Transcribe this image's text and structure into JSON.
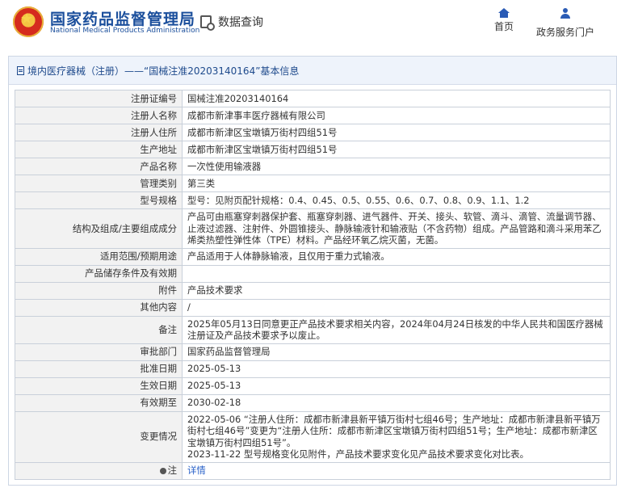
{
  "header": {
    "brand_cn": "国家药品监督管理局",
    "brand_en": "National Medical Products Administration",
    "query_label": "数据查询",
    "nav": [
      {
        "label": "首页",
        "icon": "home-icon"
      },
      {
        "label": "政务服务门户",
        "icon": "user-icon"
      }
    ]
  },
  "panel": {
    "title": "境内医疗器械（注册）——“国械注准20203140164”基本信息"
  },
  "rows": [
    {
      "label": "注册证编号",
      "value": "国械注准20203140164"
    },
    {
      "label": "注册人名称",
      "value": "成都市新津事丰医疗器械有限公司"
    },
    {
      "label": "注册人住所",
      "value": "成都市新津区宝墩镇万街村四组51号"
    },
    {
      "label": "生产地址",
      "value": "成都市新津区宝墩镇万街村四组51号"
    },
    {
      "label": "产品名称",
      "value": "一次性使用输液器"
    },
    {
      "label": "管理类别",
      "value": "第三类"
    },
    {
      "label": "型号规格",
      "value": "型号：见附页配针规格：0.4、0.45、0.5、0.55、0.6、0.7、0.8、0.9、1.1、1.2"
    },
    {
      "label": "结构及组成/主要组成成分",
      "value": "产品可由瓶塞穿刺器保护套、瓶塞穿刺器、进气器件、开关、接头、软管、滴斗、滴管、流量调节器、止液过滤器、注射件、外圆锥接头、静脉输液针和输液贴（不含药物）组成。产品管路和滴斗采用苯乙烯类热塑性弹性体（TPE）材料。产品经环氧乙烷灭菌，无菌。"
    },
    {
      "label": "适用范围/预期用途",
      "value": "产品适用于人体静脉输液，且仅用于重力式输液。"
    },
    {
      "label": "产品储存条件及有效期",
      "value": ""
    },
    {
      "label": "附件",
      "value": "产品技术要求"
    },
    {
      "label": "其他内容",
      "value": "/"
    },
    {
      "label": "备注",
      "value": "2025年05月13日同意更正产品技术要求相关内容，2024年04月24日核发的中华人民共和国医疗器械注册证及产品技术要求予以废止。"
    },
    {
      "label": "审批部门",
      "value": "国家药品监督管理局"
    },
    {
      "label": "批准日期",
      "value": "2025-05-13"
    },
    {
      "label": "生效日期",
      "value": "2025-05-13"
    },
    {
      "label": "有效期至",
      "value": "2030-02-18"
    },
    {
      "label": "变更情况",
      "value": "2022-05-06 “注册人住所：成都市新津县新平镇万街村七组46号；生产地址：成都市新津县新平镇万街村七组46号”变更为“注册人住所：成都市新津区宝墩镇万街村四组51号；生产地址：成都市新津区宝墩镇万街村四组51号”。\n2023-11-22 型号规格变化见附件，产品技术要求变化见产品技术要求变化对比表。"
    },
    {
      "label": "注",
      "value": "详情"
    }
  ]
}
